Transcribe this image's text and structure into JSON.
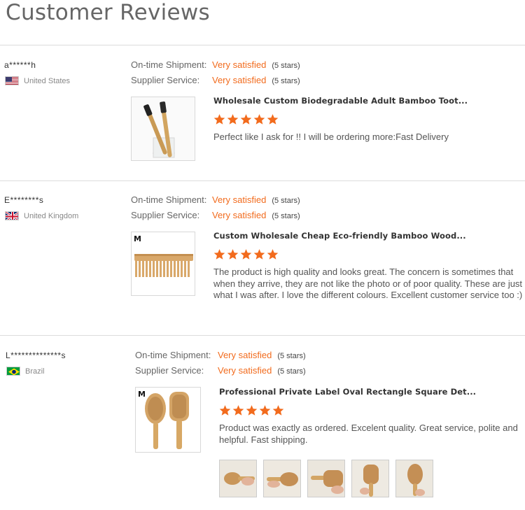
{
  "page": {
    "title": "Customer Reviews"
  },
  "colors": {
    "accent": "#f26b1d",
    "divider": "#dcdcdc"
  },
  "reviews": [
    {
      "reviewer": "a******h",
      "country": "United States",
      "flag_icon": "us-flag-icon",
      "ratings": [
        {
          "label": "On-time Shipment:",
          "value": "Very satisfied",
          "stars": "(5 stars)"
        },
        {
          "label": "Supplier Service:",
          "value": "Very satisfied",
          "stars": "(5 stars)"
        }
      ],
      "product_title": "Wholesale Custom Biodegradable Adult Bamboo Toot...",
      "star_count": 5,
      "text": "Perfect like I ask for  !! I will be ordering more:Fast Delivery"
    },
    {
      "reviewer": "E********s",
      "country": "United Kingdom",
      "flag_icon": "uk-flag-icon",
      "ratings": [
        {
          "label": "On-time Shipment:",
          "value": "Very satisfied",
          "stars": "(5 stars)"
        },
        {
          "label": "Supplier Service:",
          "value": "Very satisfied",
          "stars": "(5 stars)"
        }
      ],
      "product_title": "Custom Wholesale Cheap Eco-friendly Bamboo Wood...",
      "star_count": 5,
      "text": "The product is high quality and looks great. The concern is sometimes that when they arrive, they are not like the photo or of poor quality. These are just what I was after. I love the different colours. Excellent customer service too :)"
    },
    {
      "reviewer": "L**************s",
      "country": "Brazil",
      "flag_icon": "brazil-flag-icon",
      "ratings": [
        {
          "label": "On-time Shipment:",
          "value": "Very satisfied",
          "stars": "(5 stars)"
        },
        {
          "label": "Supplier Service:",
          "value": "Very satisfied",
          "stars": "(5 stars)"
        }
      ],
      "product_title": "Professional Private Label Oval Rectangle Square Det...",
      "star_count": 5,
      "text": "Product was exactly as ordered. Excelent quality. Great service, polite and helpful. Fast shipping.",
      "photo_count": 5
    }
  ]
}
